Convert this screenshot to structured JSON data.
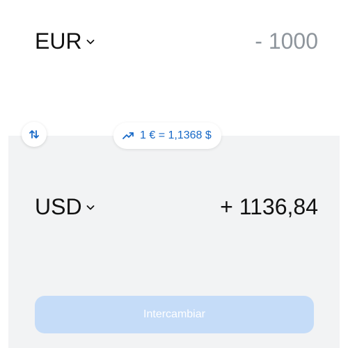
{
  "from": {
    "currency": "EUR",
    "amount": "- 1000"
  },
  "to": {
    "currency": "USD",
    "amount": "+ 1136,84"
  },
  "rate": {
    "text": "1 € = 1,1368 $",
    "icon": "trending-up-icon"
  },
  "swap": {
    "icon": "swap-vertical-icon"
  },
  "actions": {
    "exchange_label": "Intercambiar"
  },
  "colors": {
    "accent": "#1668c7",
    "panel_background": "#f2f3f4",
    "button_disabled": "#c5dcf8",
    "muted_amount": "#8e959c"
  }
}
